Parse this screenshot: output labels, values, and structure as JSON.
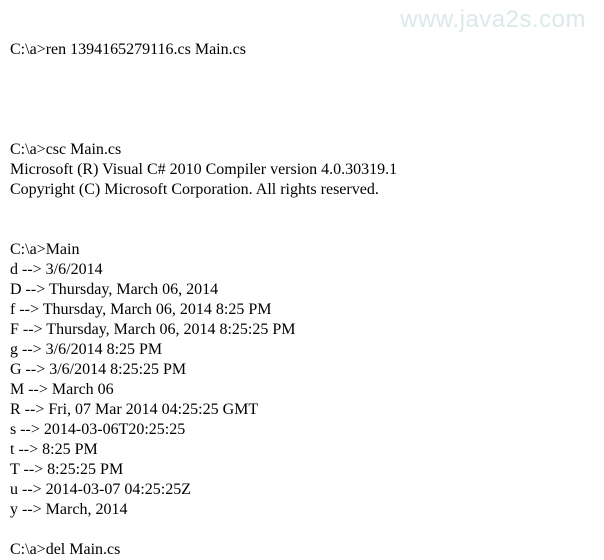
{
  "watermark": "www.java2s.com",
  "lines": {
    "ren": "C:\\a>ren 1394165279116.cs Main.cs",
    "csc": "C:\\a>csc Main.cs",
    "compiler1": "Microsoft (R) Visual C# 2010 Compiler version 4.0.30319.1",
    "compiler2": "Copyright (C) Microsoft Corporation. All rights reserved.",
    "main": "C:\\a>Main",
    "d": "d --> 3/6/2014",
    "D": "D --> Thursday, March 06, 2014",
    "f": "f --> Thursday, March 06, 2014 8:25 PM",
    "F": "F --> Thursday, March 06, 2014 8:25:25 PM",
    "g": "g --> 3/6/2014 8:25 PM",
    "G": "G --> 3/6/2014 8:25:25 PM",
    "M": "M --> March 06",
    "R": "R --> Fri, 07 Mar 2014 04:25:25 GMT",
    "s": "s --> 2014-03-06T20:25:25",
    "t": "t --> 8:25 PM",
    "T": "T --> 8:25:25 PM",
    "u": "u --> 2014-03-07 04:25:25Z",
    "y": "y --> March, 2014",
    "del": "C:\\a>del Main.cs"
  }
}
